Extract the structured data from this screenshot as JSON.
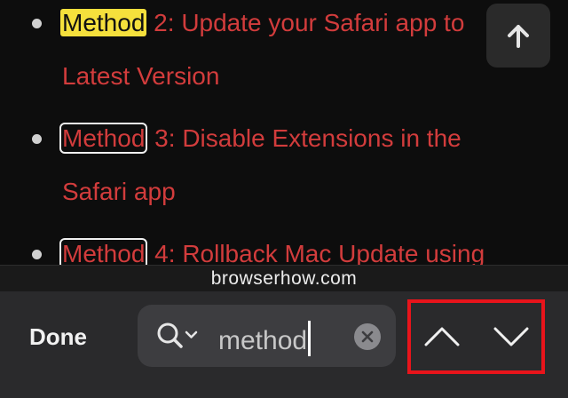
{
  "article": {
    "items": [
      {
        "highlight": "Method",
        "line1_rest": " 2: Update your Safari app to",
        "line2": "Latest Version"
      },
      {
        "highlight": "Method",
        "line1_rest": " 3: Disable Extensions in the",
        "line2": "Safari app"
      },
      {
        "highlight": "Method",
        "line1_rest": " 4: Rollback Mac Update using",
        "line2": ""
      }
    ]
  },
  "scroll_top": {
    "icon": "arrow-up-icon"
  },
  "url_bar": {
    "domain": "browserhow.com"
  },
  "find_bar": {
    "done_label": "Done",
    "search_icon": "magnifier-with-dropdown-icon",
    "query": "method",
    "clear_icon": "clear-circle-icon",
    "prev_icon": "chevron-up-icon",
    "next_icon": "chevron-down-icon"
  },
  "colors": {
    "link_text": "#d23c3c",
    "active_match": "#f5e03c",
    "annotation_box": "#e8141b"
  }
}
